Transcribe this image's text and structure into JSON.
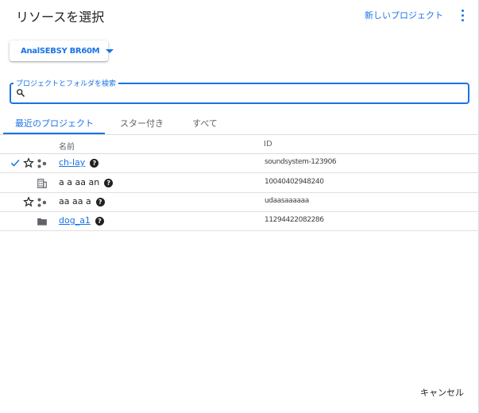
{
  "dialog": {
    "title": "リソースを選択",
    "new_project_label": "新しいプロジェクト",
    "more_icon": "more-vert-icon"
  },
  "org_selector": {
    "label": "AnalSEBSY BR60M",
    "caret_icon": "arrow-drop-down-icon"
  },
  "search": {
    "legend": "プロジェクトとフォルダを検索",
    "value": "",
    "placeholder": "",
    "icon": "search-icon"
  },
  "tabs": [
    {
      "label": "最近のプロジェクト",
      "active": true
    },
    {
      "label": "スター付き",
      "active": false
    },
    {
      "label": "すべて",
      "active": false
    }
  ],
  "table": {
    "headers": {
      "name": "名前",
      "id": "ID"
    },
    "rows": [
      {
        "selected": true,
        "starrable": true,
        "type": "project-icon",
        "name": "ch-lay",
        "id": "soundsystem-123906",
        "help": true
      },
      {
        "selected": false,
        "starrable": false,
        "type": "organization-icon",
        "name": "a a aa an",
        "id": "10040402948240",
        "help": true
      },
      {
        "selected": false,
        "starrable": true,
        "type": "project-icon",
        "name": "aa aa a",
        "id": "udaasaaaaaa",
        "help": true
      },
      {
        "selected": false,
        "starrable": false,
        "type": "folder-icon",
        "name": "dog_a1",
        "id": "11294422082286",
        "help": true
      }
    ]
  },
  "footer": {
    "cancel_label": "キャンセル"
  },
  "colors": {
    "accent": "#1a73e8",
    "text": "#202124",
    "muted": "#5f6368",
    "divider": "#dadce0"
  }
}
